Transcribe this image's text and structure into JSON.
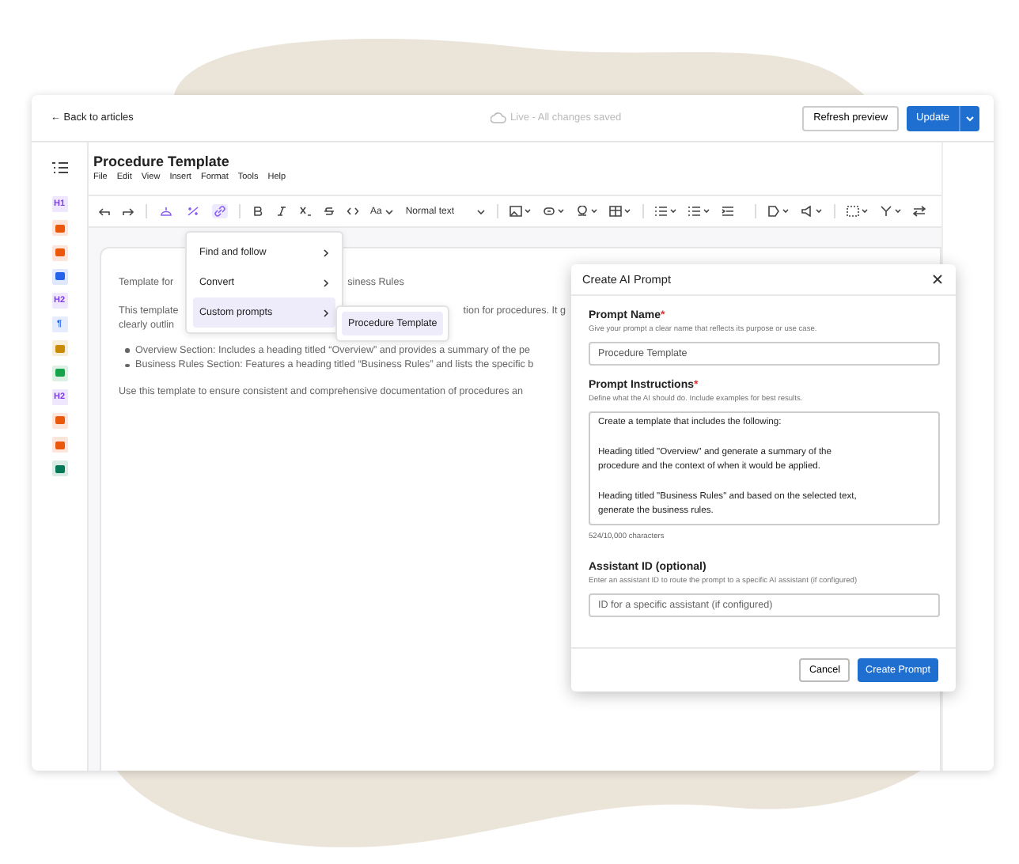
{
  "top_bar": {
    "back_link": "← Back to articles",
    "status": "Live - All changes saved",
    "refresh_button": "Refresh preview",
    "update_button": "Update"
  },
  "outline": [
    {
      "kind": "heading",
      "label": "H1",
      "color": "#7c3aed"
    },
    {
      "kind": "block",
      "color": "#ea580c"
    },
    {
      "kind": "block",
      "color": "#ea580c"
    },
    {
      "kind": "block",
      "color": "#2563eb"
    },
    {
      "kind": "heading",
      "label": "H2",
      "color": "#7c3aed"
    },
    {
      "kind": "heading",
      "label": "¶",
      "color": "#2563eb"
    },
    {
      "kind": "block",
      "color": "#ca8a04"
    },
    {
      "kind": "block",
      "color": "#16a34a"
    },
    {
      "kind": "heading",
      "label": "H2",
      "color": "#7c3aed"
    },
    {
      "kind": "block",
      "color": "#ea580c"
    },
    {
      "kind": "block",
      "color": "#ea580c"
    },
    {
      "kind": "block",
      "color": "#047857"
    }
  ],
  "editor": {
    "title": "Procedure Template",
    "menu": [
      "File",
      "Edit",
      "View",
      "Insert",
      "Format",
      "Tools",
      "Help"
    ]
  },
  "toolbar": {
    "ai_tools": [
      {
        "selected": false
      },
      {
        "selected": false
      },
      {
        "selected": true
      }
    ],
    "font_button": "Aa",
    "block_style": "Normal text"
  },
  "document": {
    "lines": [
      {
        "left": "Template for",
        "right": "siness Rules"
      },
      {
        "left": "This template",
        "right": "tion for procedures. It g"
      },
      {
        "left": "clearly outlin"
      }
    ],
    "bullets": [
      "Overview Section: Includes a heading titled “Overview” and provides a summary of the pe",
      "Business Rules Section: Features a heading titled “Business Rules” and lists the specific b"
    ],
    "closing": "Use this template to ensure consistent and comprehensive documentation of procedures an"
  },
  "context_menu": {
    "items": [
      {
        "label": "Find and follow",
        "selected": false
      },
      {
        "label": "Convert",
        "selected": false
      },
      {
        "label": "Custom prompts",
        "selected": true
      }
    ],
    "submenu": [
      "Procedure Template"
    ]
  },
  "dialog": {
    "title": "Create AI Prompt",
    "required_mark": "*",
    "name_label": "Prompt Name",
    "name_hint": "Give your prompt a clear name that reflects its purpose or use case.",
    "name_value": "Procedure Template",
    "instructions_label": "Prompt Instructions",
    "instructions_hint": "Define what the AI should do. Include examples for best results.",
    "instructions_value": "Create a template that includes the following:\n\nHeading titled \"Overview\" and generate a summary of the procedure and the context of when it would be applied.\n\nHeading titled \"Business Rules\" and based on the selected text, generate the business rules.",
    "char_count": "524/10,000 characters",
    "assistant_label": "Assistant ID (optional)",
    "assistant_hint": "Enter an assistant ID to route the prompt to a specific AI assistant (if configured)",
    "assistant_placeholder": "ID for a specific assistant (if configured)",
    "cancel_button": "Cancel",
    "create_button": "Create Prompt"
  }
}
